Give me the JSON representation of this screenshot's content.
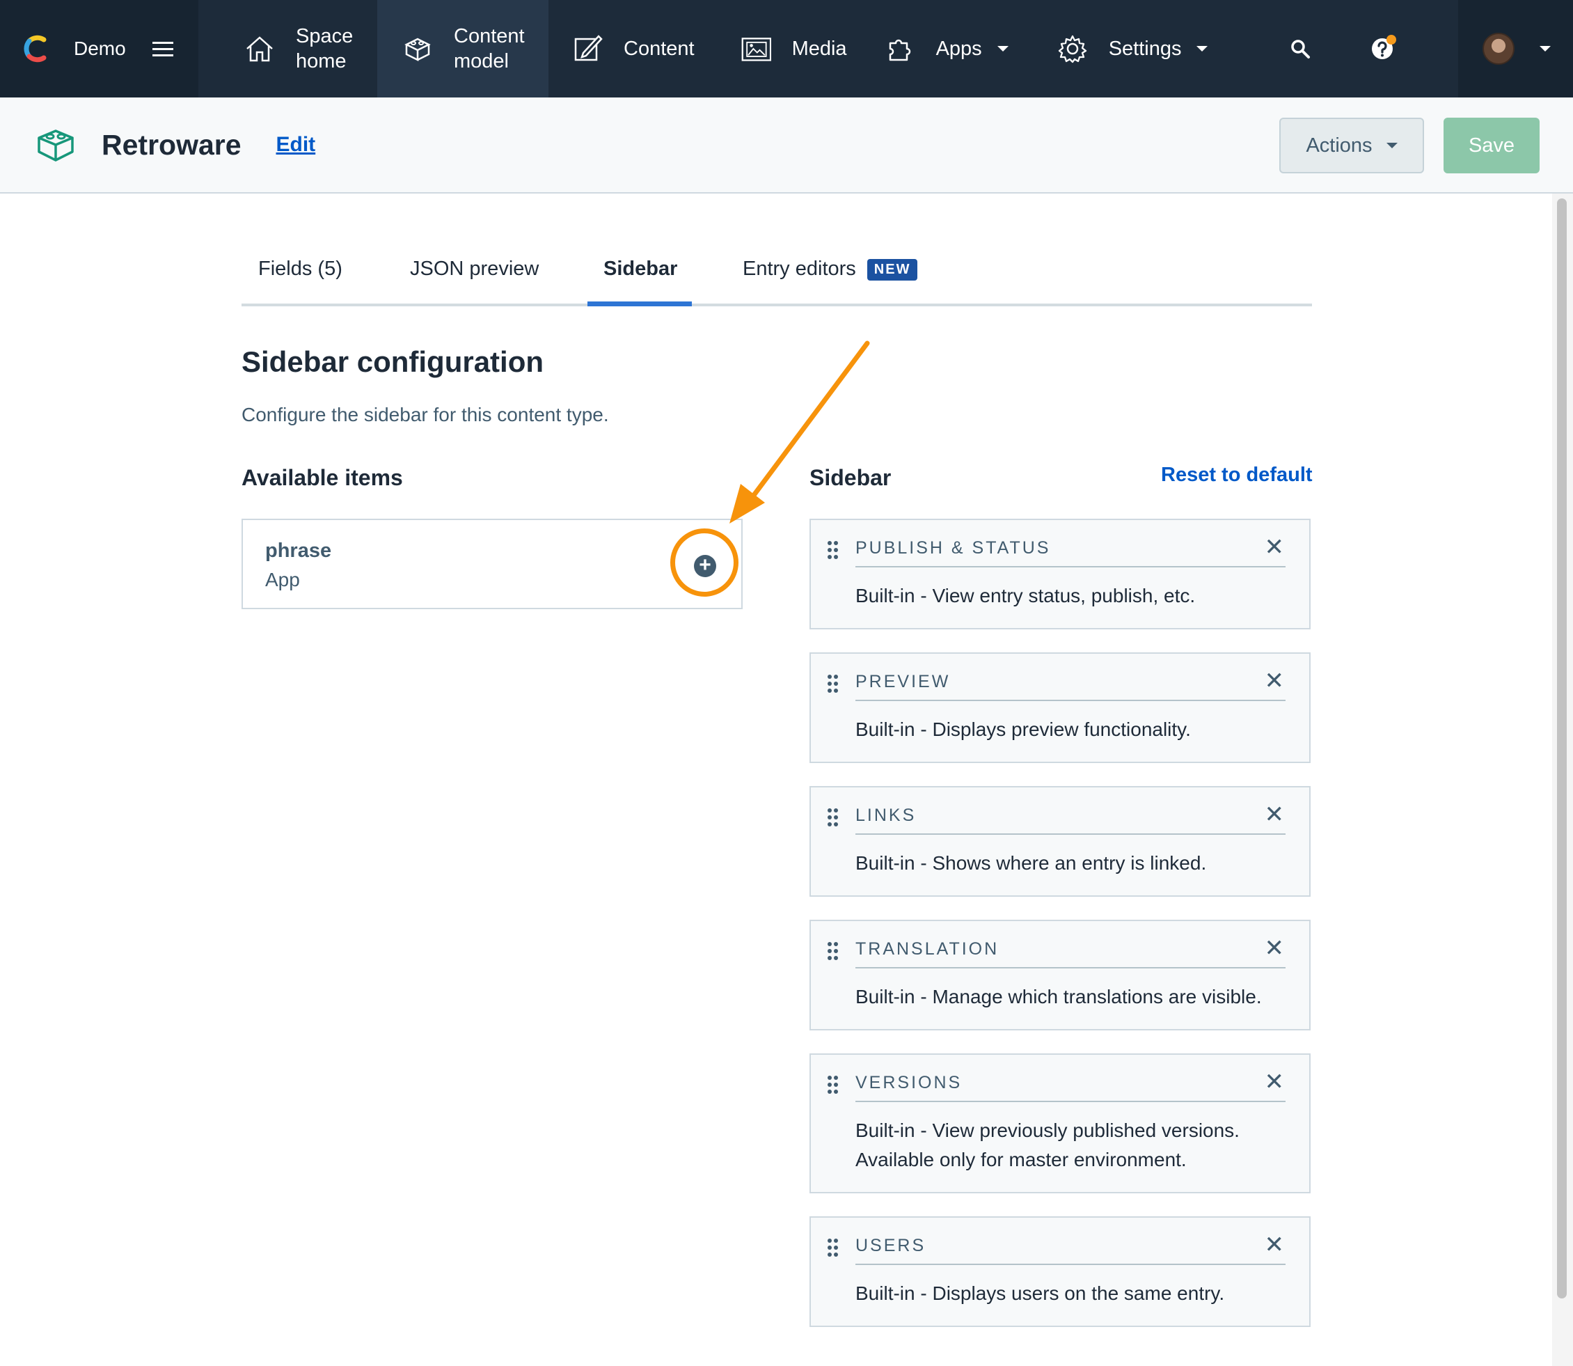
{
  "nav": {
    "space_name": "Demo",
    "items": [
      {
        "label_line1": "Space",
        "label_line2": "home",
        "icon": "home-icon"
      },
      {
        "label_line1": "Content",
        "label_line2": "model",
        "icon": "content-model-icon"
      },
      {
        "label": "Content",
        "icon": "content-icon"
      },
      {
        "label": "Media",
        "icon": "media-icon"
      },
      {
        "label": "Apps",
        "icon": "apps-icon"
      },
      {
        "label": "Settings",
        "icon": "settings-icon"
      }
    ],
    "colors": {
      "bg": "#1d2b3a",
      "active": "#27384b",
      "notification": "#f59a1c"
    }
  },
  "header": {
    "title": "Retroware",
    "edit_label": "Edit",
    "actions_label": "Actions",
    "save_label": "Save"
  },
  "tabs": [
    {
      "label": "Fields (5)"
    },
    {
      "label": "JSON preview"
    },
    {
      "label": "Sidebar",
      "active": true
    },
    {
      "label": "Entry editors",
      "badge": "NEW"
    }
  ],
  "content": {
    "title": "Sidebar configuration",
    "description": "Configure the sidebar for this content type.",
    "available_heading": "Available items",
    "sidebar_heading": "Sidebar",
    "reset_label": "Reset to default",
    "available_items": [
      {
        "name": "phrase",
        "type": "App"
      }
    ],
    "sidebar_items": [
      {
        "title": "PUBLISH & STATUS",
        "desc": "Built-in - View entry status, publish, etc."
      },
      {
        "title": "PREVIEW",
        "desc": "Built-in - Displays preview functionality."
      },
      {
        "title": "LINKS",
        "desc": "Built-in - Shows where an entry is linked."
      },
      {
        "title": "TRANSLATION",
        "desc": "Built-in - Manage which translations are visible."
      },
      {
        "title": "VERSIONS",
        "desc": "Built-in - View previously published versions. Available only for master environment."
      },
      {
        "title": "USERS",
        "desc": "Built-in - Displays users on the same entry."
      }
    ],
    "annotation_color": "#f7930b"
  }
}
